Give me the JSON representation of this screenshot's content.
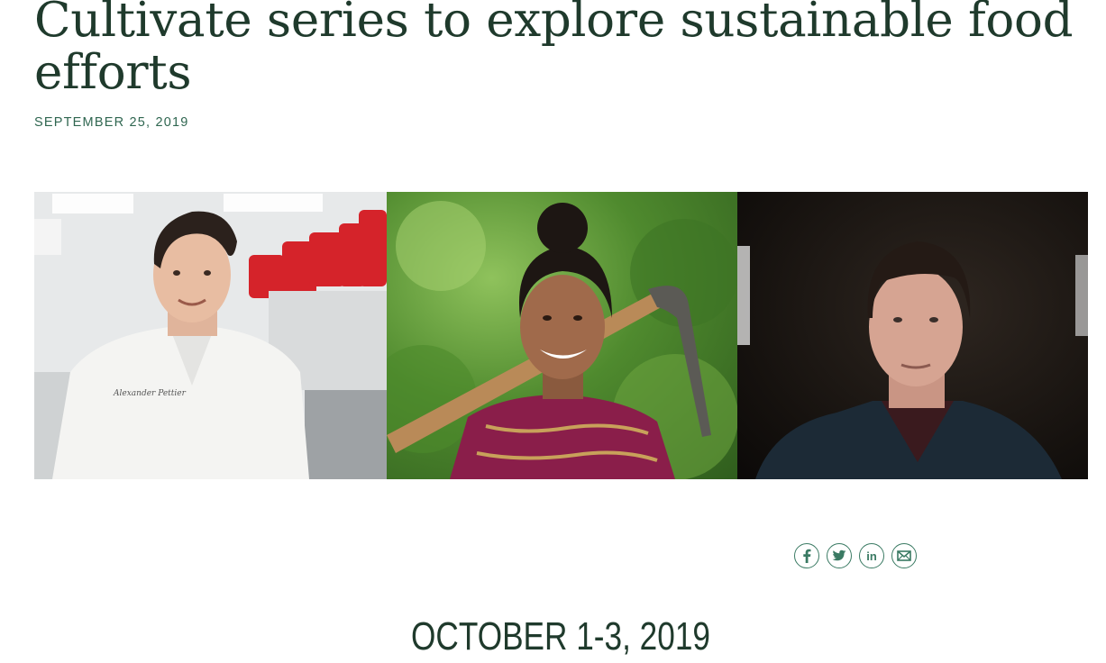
{
  "article": {
    "title": "Cultivate series to explore sustainable food efforts",
    "date": "SEPTEMBER 25, 2019"
  },
  "banner": {
    "photos": [
      {
        "name": "chef-portrait",
        "embroidery": "Alexander Pettier"
      },
      {
        "name": "farmer-portrait"
      },
      {
        "name": "man-portrait"
      }
    ]
  },
  "share": {
    "items": [
      {
        "icon": "facebook-icon"
      },
      {
        "icon": "twitter-icon"
      },
      {
        "icon": "linkedin-icon",
        "label": "in"
      },
      {
        "icon": "email-icon"
      }
    ]
  },
  "event": {
    "dates": "OCTOBER 1-3, 2019"
  },
  "colors": {
    "heading": "#1f3a2c",
    "accent": "#2f6650",
    "share_icon": "#3a7a63"
  }
}
